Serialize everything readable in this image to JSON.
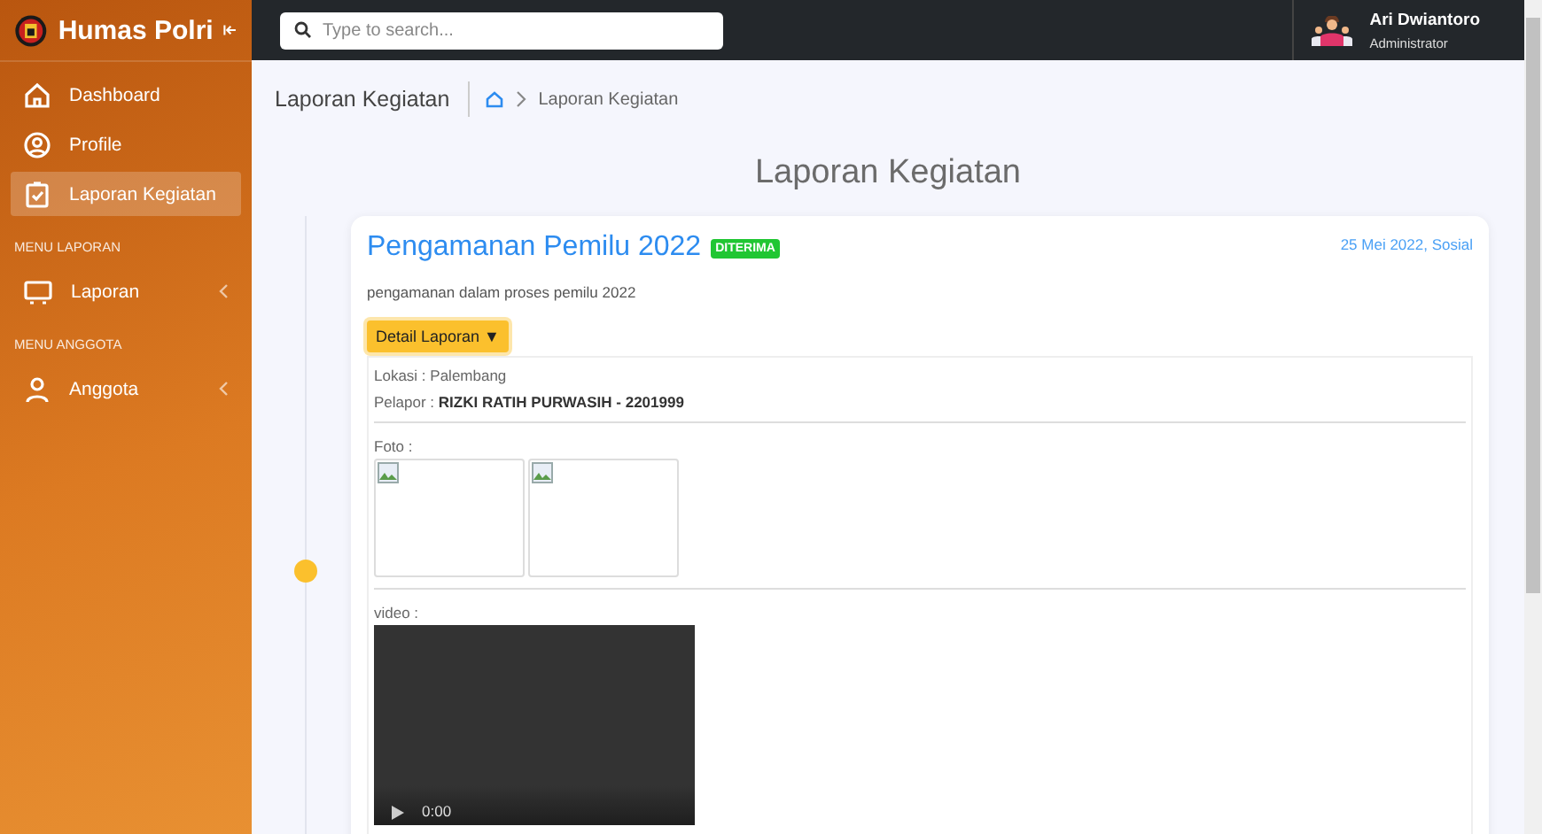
{
  "brand": {
    "title": "Humas Polri"
  },
  "sidebar": {
    "items": [
      {
        "kind": "link",
        "label": "Dashboard",
        "selected": false
      },
      {
        "kind": "link",
        "label": "Profile",
        "selected": false
      },
      {
        "kind": "link",
        "label": "Laporan Kegiatan",
        "selected": true
      },
      {
        "kind": "heading",
        "label": "MENU LAPORAN"
      },
      {
        "kind": "submenu",
        "label": "Laporan",
        "expanded": false
      },
      {
        "kind": "heading",
        "label": "MENU ANGGOTA"
      },
      {
        "kind": "submenu",
        "label": "Anggota",
        "expanded": false
      }
    ]
  },
  "topbar": {
    "search": {
      "placeholder": "Type to search..."
    },
    "user": {
      "name": "Ari Dwiantoro",
      "role": "Administrator"
    }
  },
  "breadcrumb": {
    "title": "Laporan Kegiatan",
    "current": "Laporan Kegiatan"
  },
  "page_title": "Laporan Kegiatan",
  "report": {
    "title": "Pengamanan Pemilu 2022",
    "status": "DITERIMA",
    "meta": "25 Mei 2022, Sosial",
    "description": "pengamanan dalam proses pemilu 2022",
    "detail_button": {
      "label": "Detail Laporan",
      "caret": "▼",
      "expanded": true
    },
    "details": [
      "Lokasi : Palembang",
      "Pelapor : **RIZKI RATIH PURWASIH - 2201999**"
    ],
    "photo_label": "Foto :",
    "photos": [
      {
        "kind": "broken"
      },
      {
        "kind": "broken"
      }
    ],
    "video_label": "video :",
    "video_time": "0:00"
  }
}
